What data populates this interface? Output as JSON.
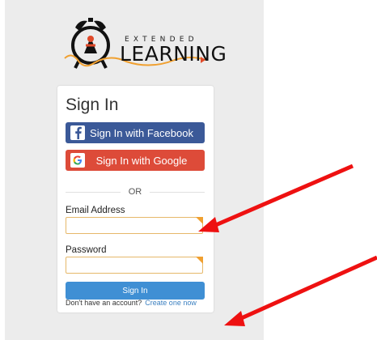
{
  "brand": {
    "word_small": "EXTENDED",
    "word_big": "LEARNING"
  },
  "signin": {
    "title": "Sign In",
    "facebook_label": "Sign In with Facebook",
    "google_label": "Sign In with Google",
    "divider_text": "OR",
    "email_label": "Email Address",
    "email_value": "",
    "password_label": "Password",
    "password_value": "",
    "submit_label": "Sign In",
    "footer_text": "Don't have an account?",
    "create_link": "Create one now"
  },
  "colors": {
    "facebook": "#3b5998",
    "google": "#dd4b39",
    "primary": "#3f8fd4",
    "input_border": "#e6b86a",
    "annotation_arrow": "#ee1111"
  }
}
